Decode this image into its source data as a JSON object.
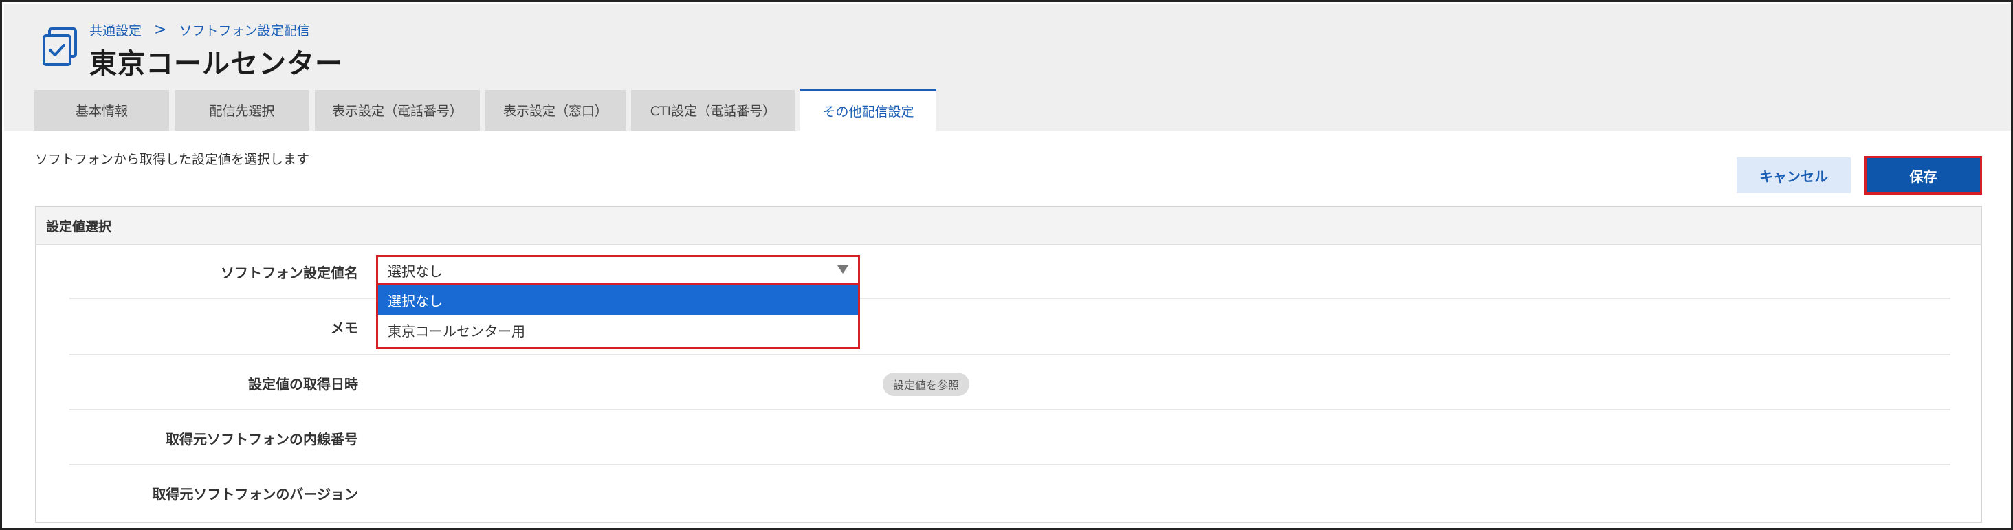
{
  "header": {
    "breadcrumb": [
      "共通設定",
      ">",
      "ソフトフォン設定配信"
    ],
    "title": "東京コールセンター",
    "accent_color": "#1a5eb5"
  },
  "tabs": [
    {
      "label": "基本情報",
      "active": false
    },
    {
      "label": "配信先選択",
      "active": false
    },
    {
      "label": "表示設定（電話番号）",
      "active": false
    },
    {
      "label": "表示設定（窓口）",
      "active": false
    },
    {
      "label": "CTI設定（電話番号）",
      "active": false
    },
    {
      "label": "その他配信設定",
      "active": true
    }
  ],
  "main": {
    "description": "ソフトフォンから取得した設定値を選択します",
    "cancel_label": "キャンセル",
    "save_label": "保存",
    "panel_title": "設定値選択",
    "rows": [
      {
        "label": "ソフトフォン設定値名"
      },
      {
        "label": "メモ"
      },
      {
        "label": "設定値の取得日時"
      },
      {
        "label": "取得元ソフトフォンの内線番号"
      },
      {
        "label": "取得元ソフトフォンのバージョン"
      }
    ],
    "select": {
      "value": "選択なし",
      "options": [
        "選択なし",
        "東京コールセンター用"
      ]
    },
    "ref_button_label": "設定値を参照"
  }
}
